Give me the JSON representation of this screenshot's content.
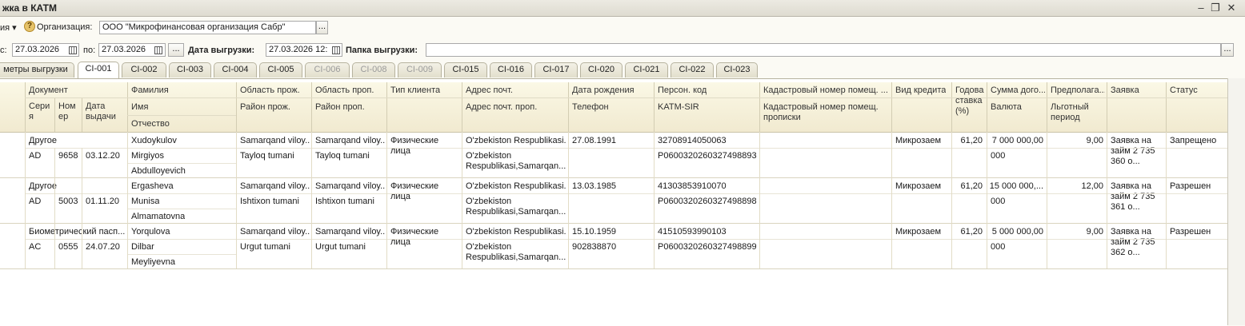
{
  "window": {
    "title": "жка в КАТМ"
  },
  "toolbar": {
    "left_fragment": "ия",
    "org_label": "Организация:",
    "org_value": "ООО \"Микрофинансовая организация Сабр\"",
    "ellipsis": "..."
  },
  "period": {
    "from_label": "с:",
    "from_value": "27.03.2026",
    "to_label": "по:",
    "to_value": "27.03.2026",
    "ellipsis": "...",
    "export_date_label": "Дата выгрузки:",
    "export_date_value": "27.03.2026 12:",
    "folder_label": "Папка выгрузки:",
    "folder_value": "",
    "folder_ellipsis": "..."
  },
  "tabs": [
    {
      "label": "метры выгрузки",
      "active": false,
      "disabled": false
    },
    {
      "label": "CI-001",
      "active": true,
      "disabled": false
    },
    {
      "label": "CI-002",
      "active": false,
      "disabled": false
    },
    {
      "label": "CI-003",
      "active": false,
      "disabled": false
    },
    {
      "label": "CI-004",
      "active": false,
      "disabled": false
    },
    {
      "label": "CI-005",
      "active": false,
      "disabled": false
    },
    {
      "label": "CI-006",
      "active": false,
      "disabled": true
    },
    {
      "label": "CI-008",
      "active": false,
      "disabled": true
    },
    {
      "label": "CI-009",
      "active": false,
      "disabled": true
    },
    {
      "label": "CI-015",
      "active": false,
      "disabled": false
    },
    {
      "label": "CI-016",
      "active": false,
      "disabled": false
    },
    {
      "label": "CI-017",
      "active": false,
      "disabled": false
    },
    {
      "label": "CI-020",
      "active": false,
      "disabled": false
    },
    {
      "label": "CI-021",
      "active": false,
      "disabled": false
    },
    {
      "label": "CI-022",
      "active": false,
      "disabled": false
    },
    {
      "label": "CI-023",
      "active": false,
      "disabled": false
    }
  ],
  "grid": {
    "headers": {
      "document": "Документ",
      "series": "Сери я",
      "number": "Ном ер",
      "issue_date": "Дата выдачи",
      "last_name": "Фамилия",
      "first_name": "Имя",
      "patronymic": "Отчество",
      "region_res": "Область прож.",
      "district_res": "Район прож.",
      "region_reg": "Область проп.",
      "district_reg": "Район проп.",
      "client_type": "Тип клиента",
      "address": "Адрес почт.",
      "address_reg": "Адрес почт. проп.",
      "birth_date": "Дата рождения",
      "phone": "Телефон",
      "pinfl": "Персон. код",
      "katm_sir": "KATM-SIR",
      "cadastre": "Кадастровый номер помещ. ...",
      "cadastre_reg": "Кадастровый номер помещ. прописки",
      "credit_type": "Вид кредита",
      "rate": "Годова ставка (%)",
      "amount": "Сумма дого...",
      "currency": "Валюта",
      "expected": "Предполага...",
      "grace": "Льготный период",
      "application": "Заявка",
      "status": "Статус"
    },
    "rows": [
      {
        "doc": "Другое",
        "series": "AD",
        "number": "9658",
        "issue_date": "03.12.20",
        "last_name": "Xudoykulov",
        "first_name": "Mirgiyos",
        "patronymic": "Abdulloyevich",
        "region_res": "Samarqand viloy...",
        "district_res": "Tayloq tumani",
        "region_reg": "Samarqand viloy...",
        "district_reg": "Tayloq tumani",
        "client_type": "Физические лица",
        "address": "O'zbekiston Respublikasi...",
        "address_reg": "O'zbekiston Respublikasi,Samarqan...",
        "birth_date": "27.08.1991",
        "phone": "",
        "pinfl": "32708914050063",
        "katm_sir": "P0600320260327498893",
        "credit_type": "Микрозаем",
        "rate": "61,20",
        "amount": "7 000 000,00",
        "currency": "000",
        "expected": "9,00",
        "application": "Заявка на займ 2 735 360 о...",
        "status": "Запрещено"
      },
      {
        "doc": "Другое",
        "series": "AD",
        "number": "5003",
        "issue_date": "01.11.20",
        "last_name": "Ergasheva",
        "first_name": "Munisa",
        "patronymic": "Almamatovna",
        "region_res": "Samarqand viloy...",
        "district_res": "Ishtixon tumani",
        "region_reg": "Samarqand viloy...",
        "district_reg": "Ishtixon tumani",
        "client_type": "Физические лица",
        "address": "O'zbekiston Respublikasi...",
        "address_reg": "O'zbekiston Respublikasi,Samarqan...",
        "birth_date": "13.03.1985",
        "phone": "",
        "pinfl": "41303853910070",
        "katm_sir": "P0600320260327498898",
        "credit_type": "Микрозаем",
        "rate": "61,20",
        "amount": "15 000 000,...",
        "currency": "000",
        "expected": "12,00",
        "application": "Заявка на займ 2 735 361 о...",
        "status": "Разрешен"
      },
      {
        "doc": "Биометрический пасп...",
        "series": "AC",
        "number": "0555",
        "issue_date": "24.07.20",
        "last_name": "Yorqulova",
        "first_name": "Dilbar",
        "patronymic": "Meyliyevna",
        "region_res": "Samarqand viloy...",
        "district_res": "Urgut tumani",
        "region_reg": "Samarqand viloy...",
        "district_reg": "Urgut tumani",
        "client_type": "Физические лица",
        "address": "O'zbekiston Respublikasi...",
        "address_reg": "O'zbekiston Respublikasi,Samarqan...",
        "birth_date": "15.10.1959",
        "phone": "902838870",
        "pinfl": "41510593990103",
        "katm_sir": "P0600320260327498899",
        "credit_type": "Микрозаем",
        "rate": "61,20",
        "amount": "5 000 000,00",
        "currency": "000",
        "expected": "9,00",
        "application": "Заявка на займ 2 735 362 о...",
        "status": "Разрешен"
      }
    ]
  }
}
